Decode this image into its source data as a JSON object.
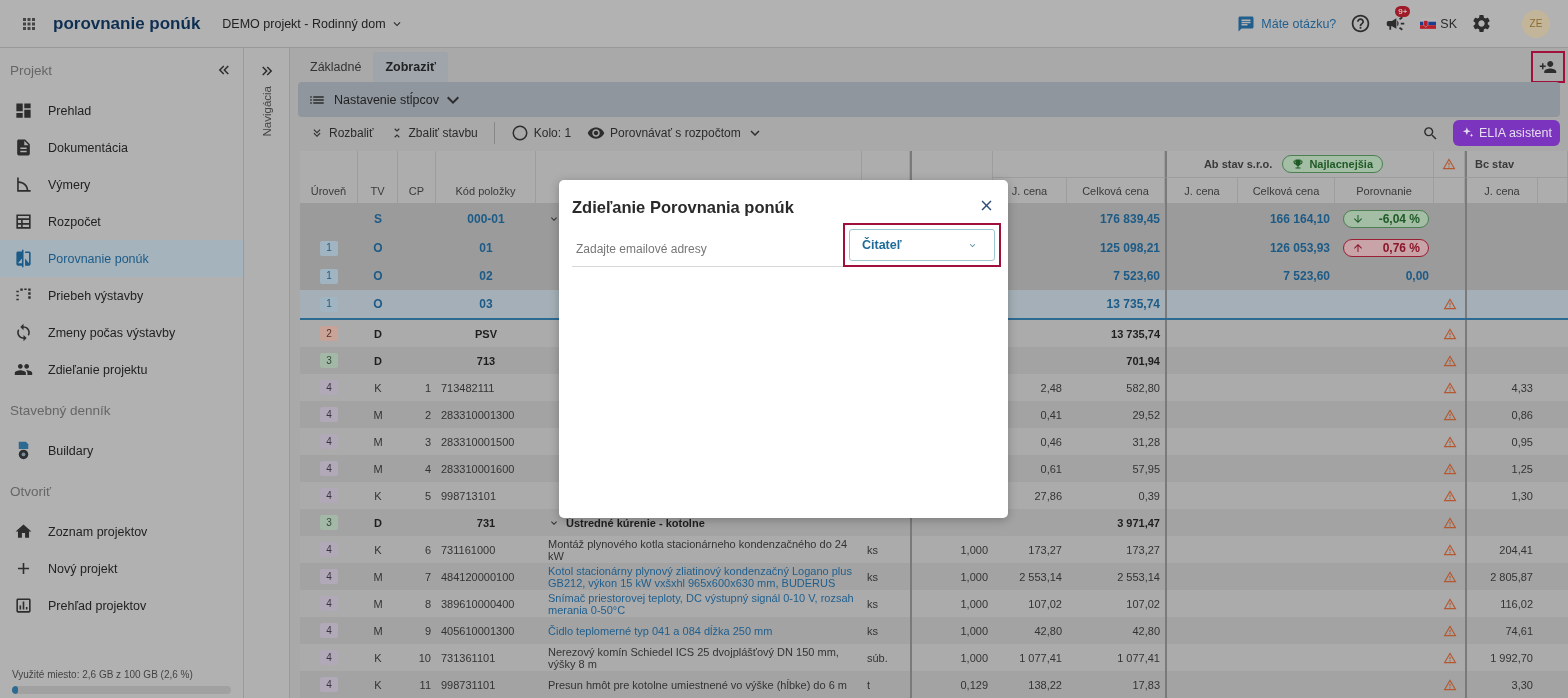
{
  "topbar": {
    "brand": "porovnanie ponúk",
    "project": "DEMO projekt - Rodinný dom",
    "help_link": "Máte otázku?",
    "notification_badge": "9+",
    "language": "SK",
    "avatar": "ZE"
  },
  "sidebar": {
    "sections": [
      {
        "title": "Projekt",
        "items": [
          {
            "label": "Prehlad",
            "selected": false
          },
          {
            "label": "Dokumentácia",
            "selected": false
          },
          {
            "label": "Výmery",
            "selected": false
          },
          {
            "label": "Rozpočet",
            "selected": false
          },
          {
            "label": "Porovnanie ponúk",
            "selected": true
          },
          {
            "label": "Priebeh výstavby",
            "selected": false
          },
          {
            "label": "Zmeny počas výstavby",
            "selected": false
          },
          {
            "label": "Zdieľanie projektu",
            "selected": false
          }
        ]
      },
      {
        "title": "Stavebný denník",
        "items": [
          {
            "label": "Buildary",
            "selected": false
          }
        ]
      },
      {
        "title": "Otvoriť",
        "items": [
          {
            "label": "Zoznam projektov",
            "selected": false
          },
          {
            "label": "Nový projekt",
            "selected": false
          },
          {
            "label": "Prehľad projektov",
            "selected": false
          }
        ]
      }
    ],
    "storage": {
      "text": "Využité miesto: 2,6 GB z 100 GB (2,6 %)",
      "level": 0.026
    }
  },
  "nav_rail": {
    "label": "Navigácia"
  },
  "tabs": [
    {
      "label": "Základné",
      "selected": false
    },
    {
      "label": "Zobraziť",
      "selected": true
    }
  ],
  "column_settings": "Nastavenie stĺpcov",
  "toolbar": {
    "expand": "Rozbaliť",
    "collapse": "Zbaliť stavbu",
    "round": "Kolo: 1",
    "compare": "Porovnávať s rozpočtom",
    "assistant": "ELIA asistent"
  },
  "table": {
    "columns": [
      "Úroveň",
      "TV",
      "CP",
      "Kód položky"
    ],
    "budget_columns": [
      "J. cena",
      "Celková cena"
    ],
    "bidders": [
      {
        "name": "Ab stav s.r.o.",
        "badge": "Najlacnejšia",
        "warning": true,
        "columns": [
          "J. cena",
          "Celková cena",
          "Porovnanie"
        ]
      },
      {
        "name": "Bc stav",
        "columns": [
          "J. cena"
        ]
      }
    ],
    "rows": [
      {
        "kind": "sum",
        "tv": "S",
        "code": "000-01",
        "expanded": true,
        "total": "176 839,45",
        "ab_total": "166 164,10",
        "comparison": {
          "kind": "down",
          "text": "-6,04 %"
        },
        "warning": false,
        "selected": false
      },
      {
        "kind": "object",
        "level": "1",
        "tv": "O",
        "code": "01",
        "expanded": false,
        "total": "125 098,21",
        "ab_total": "126 053,93",
        "comparison": {
          "kind": "up",
          "text": "0,76 %"
        },
        "warning": false,
        "selected": false
      },
      {
        "kind": "object",
        "level": "1",
        "tv": "O",
        "code": "02",
        "expanded": false,
        "total": "7 523,60",
        "ab_total": "7 523,60",
        "comparison": {
          "kind": "none",
          "text": "0,00"
        },
        "warning": false,
        "selected": false
      },
      {
        "kind": "object",
        "level": "1",
        "tv": "O",
        "code": "03",
        "expanded": false,
        "total": "13 735,74",
        "warning": true,
        "selected": true
      },
      {
        "kind": "section",
        "level": "2",
        "tv": "D",
        "code": "PSV",
        "expanded": false,
        "total": "13 735,74",
        "warning": true,
        "selected": false
      },
      {
        "kind": "section",
        "level": "3",
        "tv": "D",
        "code": "713",
        "expanded": false,
        "total": "701,94",
        "warning": true,
        "selected": false
      },
      {
        "kind": "item",
        "level": "4",
        "tv": "K",
        "cp": "1",
        "code": "713482111",
        "expanded": false,
        "price": "2,48",
        "total": "582,80",
        "warning": true,
        "bc_price": "4,33",
        "selected": false
      },
      {
        "kind": "item",
        "level": "4",
        "tv": "M",
        "cp": "2",
        "code": "283310001300",
        "expanded": false,
        "price": "0,41",
        "total": "29,52",
        "warning": true,
        "bc_price": "0,86",
        "selected": false
      },
      {
        "kind": "item",
        "level": "4",
        "tv": "M",
        "cp": "3",
        "code": "283310001500",
        "expanded": false,
        "price": "0,46",
        "total": "31,28",
        "warning": true,
        "bc_price": "0,95",
        "selected": false
      },
      {
        "kind": "item",
        "level": "4",
        "tv": "M",
        "cp": "4",
        "code": "283310001600",
        "expanded": false,
        "price": "0,61",
        "total": "57,95",
        "warning": true,
        "bc_price": "1,25",
        "selected": false
      },
      {
        "kind": "item",
        "level": "4",
        "tv": "K",
        "cp": "5",
        "code": "998713101",
        "expanded": false,
        "price": "27,86",
        "total": "0,39",
        "warning": true,
        "bc_price": "1,30",
        "selected": false
      },
      {
        "kind": "section",
        "level": "3",
        "tv": "D",
        "code": "731",
        "expanded": true,
        "link": false,
        "description": "Ústredné kúrenie - kotolne",
        "total": "3 971,47",
        "warning": true,
        "selected": false
      },
      {
        "kind": "item",
        "level": "4",
        "tv": "K",
        "cp": "6",
        "code": "731161000",
        "expanded": false,
        "link": false,
        "description": "Montáž plynového kotla stacionárneho kondenzačného do 24 kW",
        "unit": "ks",
        "qty": "1,000",
        "price": "173,27",
        "total": "173,27",
        "warning": true,
        "bc_price": "204,41",
        "selected": false
      },
      {
        "kind": "item",
        "level": "4",
        "tv": "M",
        "cp": "7",
        "code": "484120000100",
        "expanded": false,
        "link": true,
        "description": "Kotol stacionárny plynový zliatinový kondenzačný Logano plus GB212, výkon 15 kW vxšxhl 965x600x630 mm, BUDERUS",
        "unit": "ks",
        "qty": "1,000",
        "price": "2 553,14",
        "total": "2 553,14",
        "warning": true,
        "bc_price": "2 805,87",
        "selected": false
      },
      {
        "kind": "item",
        "level": "4",
        "tv": "M",
        "cp": "8",
        "code": "389610000400",
        "expanded": false,
        "link": true,
        "description": "Snímač priestorovej teploty, DC výstupný signál 0-10 V, rozsah merania 0-50°C",
        "unit": "ks",
        "qty": "1,000",
        "price": "107,02",
        "total": "107,02",
        "warning": true,
        "bc_price": "116,02",
        "selected": false
      },
      {
        "kind": "item",
        "level": "4",
        "tv": "M",
        "cp": "9",
        "code": "405610001300",
        "expanded": false,
        "link": true,
        "description": "Čidlo teplomerné typ 041 a 084 dĺžka 250 mm",
        "unit": "ks",
        "qty": "1,000",
        "price": "42,80",
        "total": "42,80",
        "warning": true,
        "bc_price": "74,61",
        "selected": false
      },
      {
        "kind": "item",
        "level": "4",
        "tv": "K",
        "cp": "10",
        "code": "731361101",
        "expanded": false,
        "link": false,
        "description": "Nerezový komín Schiedel ICS 25 dvojplášťový DN 150 mm, výšky 8 m",
        "unit": "súb.",
        "qty": "1,000",
        "price": "1 077,41",
        "total": "1 077,41",
        "warning": true,
        "bc_price": "1 992,70",
        "selected": false
      },
      {
        "kind": "item",
        "level": "4",
        "tv": "K",
        "cp": "11",
        "code": "998731101",
        "expanded": false,
        "link": false,
        "description": "Presun hmôt pre kotolne umiestnené vo výške (hĺbke) do 6 m",
        "unit": "t",
        "qty": "0,129",
        "price": "138,22",
        "total": "17,83",
        "warning": true,
        "bc_price": "3,30",
        "selected": false
      }
    ]
  },
  "dialog": {
    "title": "Zdieľanie Porovnania ponúk",
    "email_placeholder": "Zadajte emailové adresy",
    "role": "Čitateľ"
  }
}
